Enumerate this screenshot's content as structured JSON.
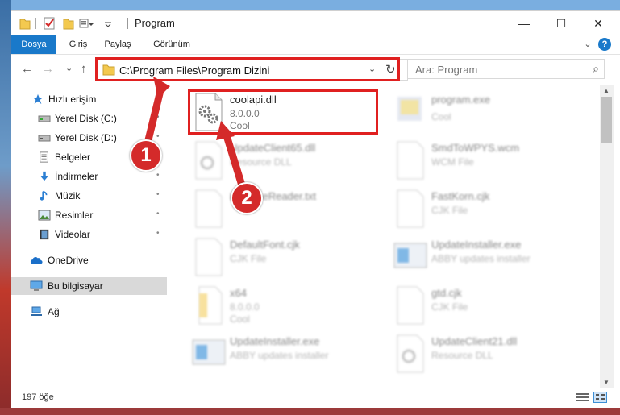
{
  "window": {
    "title": "Program",
    "minimize_glyph": "—",
    "maximize_glyph": "☐",
    "close_glyph": "✕"
  },
  "ribbon": {
    "tabs": [
      "Dosya",
      "Giriş",
      "Paylaş",
      "Görünüm"
    ],
    "expand_glyph": "⌄",
    "help_glyph": "?"
  },
  "nav": {
    "back": "←",
    "forward": "→",
    "recent": "⌄",
    "up": "↑",
    "address": "C:\\Program Files\\Program Dizini",
    "refresh": "↻",
    "dropdown": "⌄",
    "search_placeholder": "Ara: Program",
    "search_glyph": "⌕"
  },
  "sidebar": {
    "items": [
      {
        "label": "Hızlı erişim",
        "icon": "star-icon"
      },
      {
        "label": "Yerel Disk (C:)",
        "icon": "drive-icon"
      },
      {
        "label": "Yerel Disk (D:)",
        "icon": "drive-icon"
      },
      {
        "label": "Belgeler",
        "icon": "documents-icon"
      },
      {
        "label": "İndirmeler",
        "icon": "download-icon"
      },
      {
        "label": "Müzik",
        "icon": "music-icon"
      },
      {
        "label": "Resimler",
        "icon": "pictures-icon"
      },
      {
        "label": "Videolar",
        "icon": "videos-icon"
      },
      {
        "label": "OneDrive",
        "icon": "cloud-icon"
      },
      {
        "label": "Bu bilgisayar",
        "icon": "computer-icon"
      },
      {
        "label": "Ağ",
        "icon": "network-icon"
      }
    ],
    "pin_glyph": "📌"
  },
  "files": [
    {
      "name": "coolapi.dll",
      "line2": "8.0.0.0",
      "line3": "Cool",
      "icon": "dll-icon"
    },
    {
      "name": "program.exe",
      "line2": "",
      "line3": "Cool",
      "icon": "exe-icon"
    },
    {
      "name": "UpdateClient65.dll",
      "line2": "Resource DLL",
      "line3": "",
      "icon": "dll-icon"
    },
    {
      "name": "SmdToWPYS.wcm",
      "line2": "WCM File",
      "line3": "",
      "icon": "file-icon"
    },
    {
      "name": "ReleaseReader.txt",
      "line2": "",
      "line3": "",
      "icon": "file-icon"
    },
    {
      "name": "FastKorn.cjk",
      "line2": "CJK File",
      "line3": "",
      "icon": "file-icon"
    },
    {
      "name": "DefaultFont.cjk",
      "line2": "CJK File",
      "line3": "",
      "icon": "file-icon"
    },
    {
      "name": "UpdateInstaller.exe",
      "line2": "ABBY updates installer",
      "line3": "",
      "icon": "installer-icon"
    },
    {
      "name": "x64",
      "line2": "8.0.0.0",
      "line3": "Cool",
      "icon": "folder-file-icon"
    },
    {
      "name": "gtd.cjk",
      "line2": "CJK File",
      "line3": "",
      "icon": "file-icon"
    },
    {
      "name": "UpdateInstaller.exe",
      "line2": "ABBY updates installer",
      "line3": "",
      "icon": "installer-icon"
    },
    {
      "name": "UpdateClient21.dll",
      "line2": "Resource DLL",
      "line3": "",
      "icon": "dll-icon"
    }
  ],
  "status": {
    "count": "197 öğe"
  },
  "markers": [
    "1",
    "2"
  ],
  "colors": {
    "accent": "#1979ca",
    "highlight": "#e02020",
    "selected": "#d9d9d9"
  }
}
